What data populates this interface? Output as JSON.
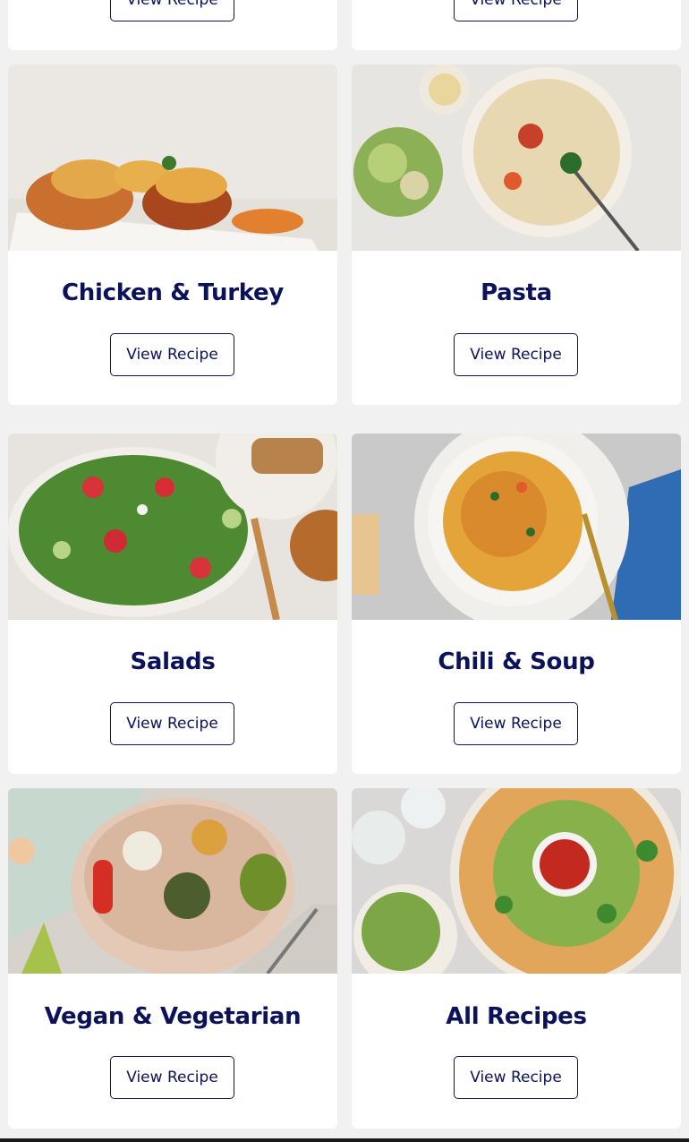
{
  "cards": [
    {
      "title": "",
      "button": "View Recipe"
    },
    {
      "title": "",
      "button": "View Recipe"
    },
    {
      "title": "Chicken & Turkey",
      "button": "View Recipe"
    },
    {
      "title": "Pasta",
      "button": "View Recipe"
    },
    {
      "title": "Salads",
      "button": "View Recipe"
    },
    {
      "title": "Chili & Soup",
      "button": "View Recipe"
    },
    {
      "title": "Vegan & Vegetarian",
      "button": "View Recipe"
    },
    {
      "title": "All Recipes",
      "button": "View Recipe"
    }
  ],
  "colors": {
    "title": "#0b1259",
    "background": "#f1f1f1",
    "card": "#ffffff"
  }
}
